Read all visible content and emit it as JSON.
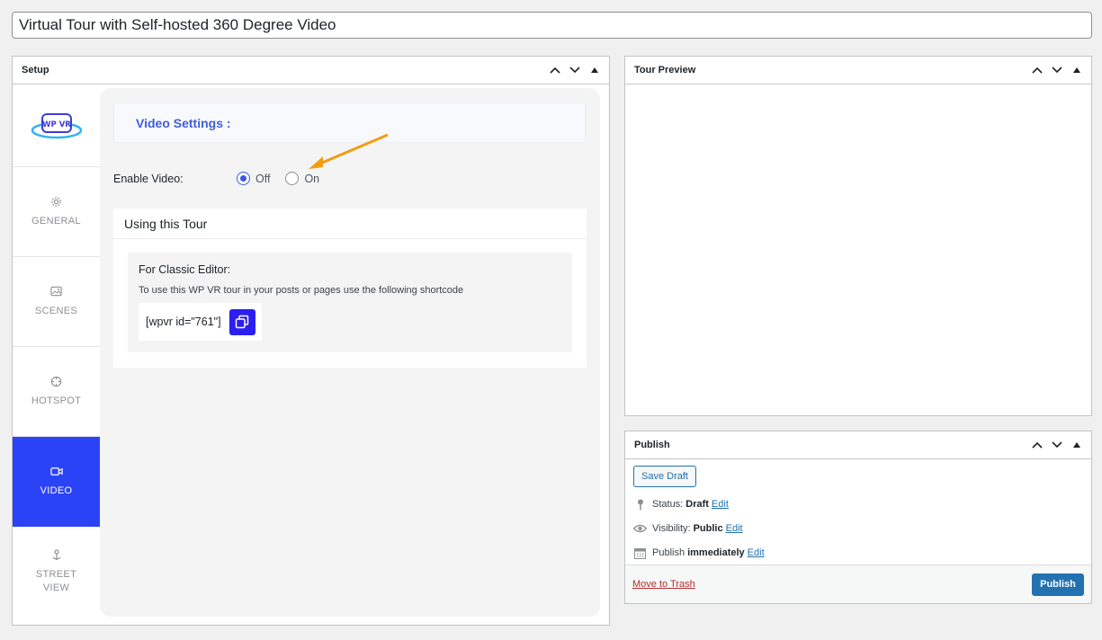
{
  "post_title": "Virtual Tour with Self-hosted 360 Degree Video",
  "setup": {
    "title": "Setup",
    "logo_text": "WP VR",
    "nav": [
      {
        "label": "GENERAL",
        "icon": "gear-icon"
      },
      {
        "label": "SCENES",
        "icon": "image-icon"
      },
      {
        "label": "HOTSPOT",
        "icon": "crosshair-icon"
      },
      {
        "label": "VIDEO",
        "icon": "video-icon",
        "active": true
      },
      {
        "label": "STREET VIEW",
        "icon": "pin-icon"
      }
    ],
    "video_settings_title": "Video Settings :",
    "enable_video_label": "Enable Video:",
    "radio_off": "Off",
    "radio_on": "On",
    "selected": "Off",
    "using_title": "Using this Tour",
    "classic_title": "For Classic Editor:",
    "classic_desc": "To use this WP VR tour in your posts or pages use the following shortcode",
    "shortcode": "[wpvr id=\"761\"]"
  },
  "preview": {
    "title": "Tour Preview"
  },
  "publish": {
    "title": "Publish",
    "save_draft": "Save Draft",
    "status_label": "Status:",
    "status_value": "Draft",
    "visibility_label": "Visibility:",
    "visibility_value": "Public",
    "publish_label": "Publish",
    "publish_value": "immediately",
    "edit": "Edit",
    "trash": "Move to Trash",
    "publish_btn": "Publish"
  },
  "colors": {
    "accent": "#2b43f7",
    "wp_blue": "#2271b1",
    "arrow": "#f39c12",
    "trash": "#b32d2e"
  }
}
